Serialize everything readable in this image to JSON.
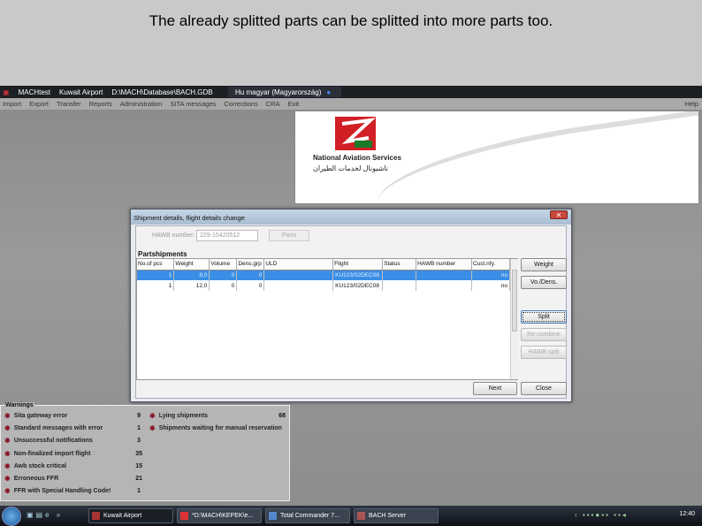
{
  "caption": "The already splitted parts can be splitted into more parts too.",
  "app": {
    "title": "MACHtest",
    "location": "Kuwait Airport",
    "db_path": "D:\\MACH\\Database\\BACH.GDB",
    "language": "Hu magyar (Magyarország)"
  },
  "menu": [
    "Import",
    "Export",
    "Transfer",
    "Reports",
    "Administration",
    "SITA messages",
    "Corrections",
    "CRA",
    "Exit"
  ],
  "help": "Help",
  "logo": {
    "name_en": "National Aviation Services",
    "name_ar": "ناشيونال لخدمات الطيران",
    "emblem": "NAS"
  },
  "dialog": {
    "title": "Shipment details, flight details change",
    "close": "✕",
    "hawb_label": "HAWB number:",
    "hawb_value": "229-15420512",
    "parts_button": "Parts",
    "section": "Partshipments",
    "columns": [
      "No.of pcs",
      "Weight",
      "Volume",
      "Dens.grp",
      "ULD",
      "Flight",
      "Status",
      "HAWB number",
      "Cust.nfy."
    ],
    "rows": [
      {
        "pcs": "1",
        "weight": "8,0",
        "volume": "0",
        "dens": "0",
        "uld": "",
        "flight": "KU123/02DEC08",
        "status": "",
        "hawb": "",
        "cust": "no",
        "selected": true
      },
      {
        "pcs": "1",
        "weight": "12,0",
        "volume": "0",
        "dens": "0",
        "uld": "",
        "flight": "KU123/02DEC08",
        "status": "",
        "hawb": "",
        "cust": "no",
        "selected": false
      }
    ],
    "buttons": {
      "weight": "Weight",
      "vol_dens": "Vo./Dens.",
      "split": "Split",
      "recombine": "Re-combine",
      "hawb_split": "HAWB split",
      "next": "Next",
      "close": "Close"
    }
  },
  "warnings": {
    "title": "Warnings",
    "left": [
      {
        "label": "Sita gateway error",
        "count": "9"
      },
      {
        "label": "Standard messages with error",
        "count": "1"
      },
      {
        "label": "Unsuccessful notifications",
        "count": "3"
      },
      {
        "label": "Non-finalized import flight",
        "count": "35"
      },
      {
        "label": "Awb stock critical",
        "count": "15"
      },
      {
        "label": "Erroneous FFR",
        "count": "21"
      },
      {
        "label": "FFR with Special Handling Code!",
        "count": "1"
      }
    ],
    "right": [
      {
        "label": "Lying shipments",
        "count": "68"
      },
      {
        "label": "Shipments waiting for manual reservation",
        "count": ""
      }
    ]
  },
  "taskbar": {
    "items": [
      "Kuwait Airport",
      "*D:\\MACH\\KEPEK\\e...",
      "Total Commander 7...",
      "BACH Server"
    ],
    "clock": "12:40"
  }
}
